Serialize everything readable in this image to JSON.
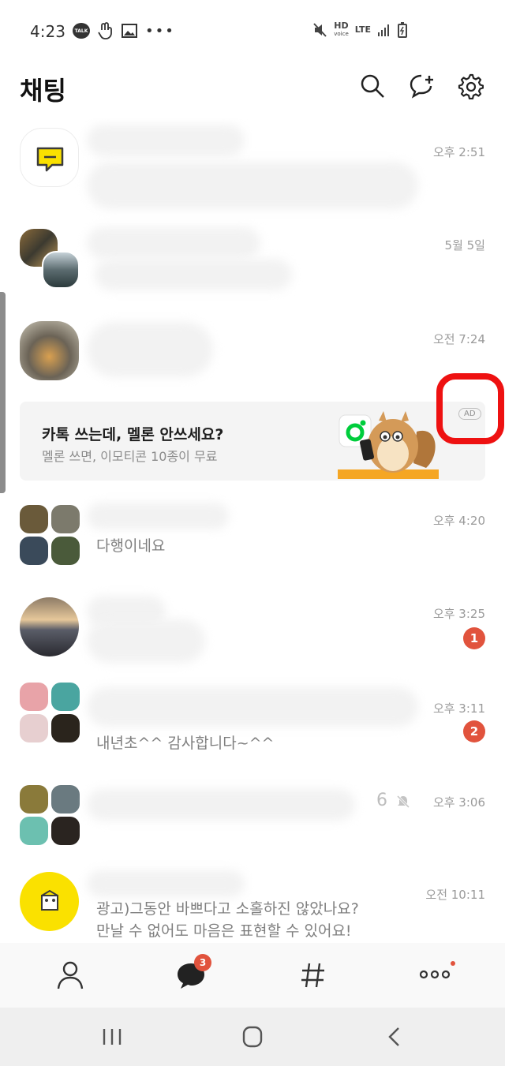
{
  "status": {
    "time": "4:23",
    "talk_label": "TALK",
    "hd_label": "HD",
    "hd_sub": "voice",
    "lte_label": "LTE"
  },
  "header": {
    "title": "채팅"
  },
  "chats": [
    {
      "time": "오후 2:51",
      "preview": ""
    },
    {
      "time": "5월 5일",
      "preview": ""
    },
    {
      "time": "오전 7:24",
      "preview": ""
    },
    {
      "time": "오후 4:20",
      "preview": "다행이네요"
    },
    {
      "time": "오후 3:25",
      "preview": "",
      "unread": "1"
    },
    {
      "time": "오후 3:11",
      "preview": "내년초^^ 감사합니다~^^",
      "unread": "2"
    },
    {
      "time": "오후 3:06",
      "preview": "",
      "member_count": "6"
    },
    {
      "time": "오전 10:11",
      "preview_line1": "광고)그동안 바쁘다고 소홀하진 않았나요?",
      "preview_line2": "만날 수 없어도 마음은 표현할 수 있어요!"
    }
  ],
  "ad": {
    "title": "카톡 쓰는데, 멜론 안쓰세요?",
    "subtitle": "멜론 쓰면, 이모티콘 10종이 무료",
    "label": "AD"
  },
  "bottom_nav": {
    "chat_badge": "3"
  },
  "colors": {
    "badge": "#e1533d",
    "kakao_yellow": "#fae100",
    "highlight": "#ee1111",
    "melon_green": "#00cd3c"
  }
}
